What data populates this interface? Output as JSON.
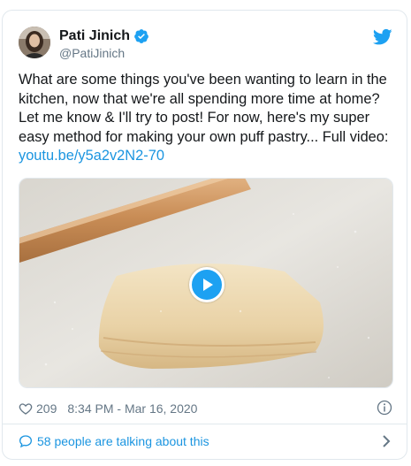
{
  "author": {
    "display_name": "Pati Jinich",
    "handle": "@PatiJinich"
  },
  "tweet": {
    "text": "What are some things you've been wanting to learn in the kitchen, now that we're all spending more time at home? Let me know & I'll try to post! For now, here's my super easy method for making your own puff pastry... Full video: ",
    "link": "youtu.be/y5a2v2N2-70"
  },
  "media": {
    "type": "video",
    "icon": "play-icon"
  },
  "meta": {
    "likes": "209",
    "timestamp": "8:34 PM - Mar 16, 2020"
  },
  "footer": {
    "conversation_label": "58 people are talking about this"
  },
  "colors": {
    "accent": "#1da1f2",
    "link": "#1b95e0",
    "secondary_text": "#657786",
    "border": "#e1e8ed"
  }
}
